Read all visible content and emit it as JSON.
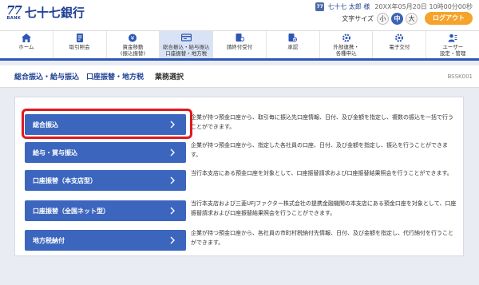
{
  "brand": {
    "logo_mark": "77",
    "logo_sub": "BANK",
    "name": "七十七銀行"
  },
  "header": {
    "user_icon": "77",
    "user_name": "七十七 太郎 様",
    "login_time": "20XX年05月20日 10時00分00秒",
    "font_size_label": "文字サイズ",
    "font_sizes": [
      "小",
      "中",
      "大"
    ],
    "font_size_selected": "中",
    "logout_label": "ログアウト"
  },
  "nav": {
    "items": [
      {
        "label": "ホーム",
        "icon": "home-icon"
      },
      {
        "label": "取引照会",
        "icon": "document-list-icon"
      },
      {
        "label": "資金移動\n(振込振替)",
        "icon": "yen-transfer-icon"
      },
      {
        "label": "総合振込・給与振込\n口座振替・地方税",
        "icon": "card-transfer-icon",
        "active": true
      },
      {
        "label": "請終付受付",
        "icon": "document-person-icon"
      },
      {
        "label": "承認",
        "icon": "approval-stamp-icon"
      },
      {
        "label": "外部連携・\n各種申込",
        "icon": "link-gear-icon"
      },
      {
        "label": "電子交付",
        "icon": "gear-document-icon"
      },
      {
        "label": "ユーザー\n設定・管理",
        "icon": "user-settings-icon"
      }
    ]
  },
  "title": {
    "main": "総合振込・給与振込　口座振替・地方税",
    "sub": "業務選択",
    "screen_id": "BSSK001"
  },
  "menu": {
    "items": [
      {
        "label": "総合振込",
        "desc": "企業が持つ預金口座から、取引毎に振込先口座情報、日付、及び金額を指定し、複数の振込を一括で行うことができます。"
      },
      {
        "label": "給与・賞与振込",
        "desc": "企業が持つ預金口座から、指定した各社員の口座、日付、及び金額を指定し、振込を行うことができます。"
      },
      {
        "label": "口座振替（本支店型）",
        "desc": "当行本支店にある預金口座を対象として、口座振替請求および口座振替結果照会を行うことができます。"
      },
      {
        "label": "口座振替（全国ネット型）",
        "desc": "当行本支店および三菱UFJファクター株式会社の提携金融機関の本支店にある預金口座を対象として、口座振替請求および口座振替結果照会を行うことができます。"
      },
      {
        "label": "地方税納付",
        "desc": "企業が持つ預金口座から、各社員の市町村税納付先情報、日付、及び金額を指定し、代行納付を行うことができます。"
      }
    ]
  },
  "colors": {
    "brand_blue": "#1d3f93",
    "button_blue": "#3c66be",
    "logout_orange": "#f5a32a",
    "highlight_red": "#e0191e"
  }
}
